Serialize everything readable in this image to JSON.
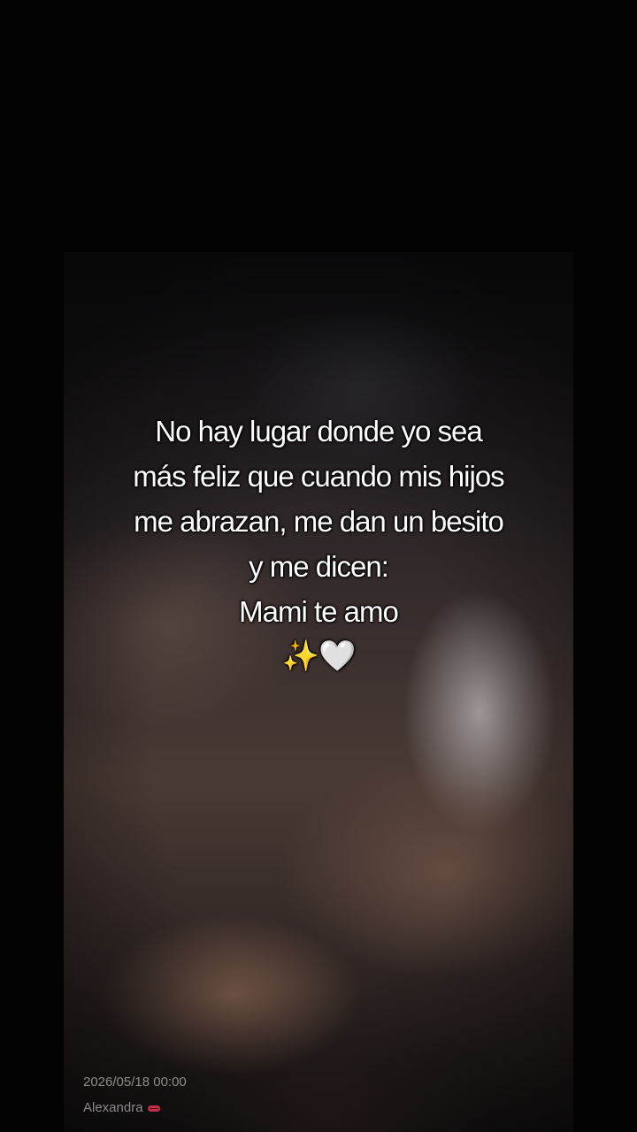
{
  "caption": {
    "line1": "No hay lugar donde yo sea",
    "line2": "más feliz que cuando mis hijos",
    "line3": "me abrazan, me dan un besito",
    "line4": "y me dicen:",
    "line5": "Mami te amo",
    "emoji": "✨🤍"
  },
  "watermark": {
    "timestamp": "2026/05/18 00:00",
    "author": "Alexandra",
    "author_icon": "lips-icon"
  },
  "colors": {
    "background": "#000000",
    "caption_text": "#ffffff",
    "watermark_text": "#aaaaaa"
  }
}
